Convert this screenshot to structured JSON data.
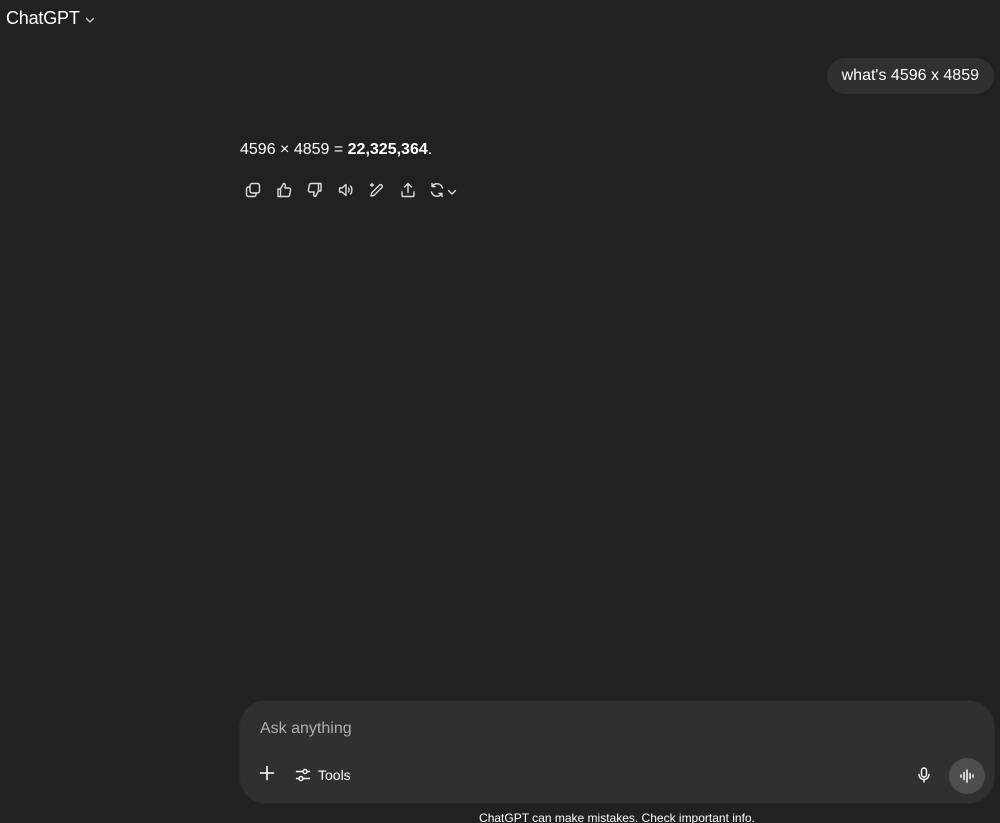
{
  "header": {
    "model_name": "ChatGPT",
    "model_menu_icon": "chevron-down-icon"
  },
  "conversation": {
    "user_message": "what's 4596 x 4859",
    "assistant_prefix": "4596 × 4859 = ",
    "assistant_result": "22,325,364",
    "assistant_suffix": ".",
    "actions": [
      {
        "name": "copy",
        "icon": "copy-icon"
      },
      {
        "name": "good-response",
        "icon": "thumbs-up-icon"
      },
      {
        "name": "bad-response",
        "icon": "thumbs-down-icon"
      },
      {
        "name": "read-aloud",
        "icon": "speaker-icon"
      },
      {
        "name": "edit-in-canvas",
        "icon": "pencil-sparkle-icon"
      },
      {
        "name": "share",
        "icon": "share-icon"
      },
      {
        "name": "regenerate",
        "icon": "refresh-icon"
      }
    ]
  },
  "composer": {
    "placeholder": "Ask anything",
    "value": "",
    "add_icon": "plus-icon",
    "tools_label": "Tools",
    "tools_icon": "sliders-icon",
    "dictate_icon": "microphone-icon",
    "voice_mode_icon": "voice-waveform-icon"
  },
  "footer": {
    "disclaimer": "ChatGPT can make mistakes. Check important info."
  },
  "colors": {
    "background": "#212121",
    "bubble": "#303030",
    "composer": "#303030",
    "voice_button": "#4e4e4e",
    "text": "#ffffff",
    "placeholder": "#afafaf"
  }
}
